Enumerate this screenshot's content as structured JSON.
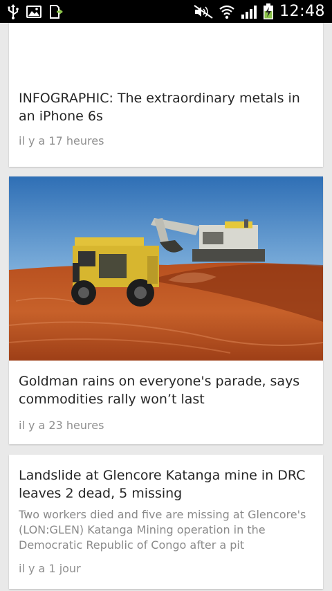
{
  "status_bar": {
    "time": "12:48",
    "icons_left": [
      "usb-icon",
      "image-icon",
      "download-icon"
    ],
    "icons_right": [
      "mute-icon",
      "wifi-icon",
      "signal-icon",
      "battery-icon"
    ],
    "accent": "#8bc34a"
  },
  "feed": {
    "cards": [
      {
        "title": "INFOGRAPHIC: The extraordinary metals in an iPhone 6s",
        "time": "il y a 17 heures"
      },
      {
        "image": "mining-truck-excavator-photo",
        "title": "Goldman rains on everyone's parade, says commodities rally won’t last",
        "time": "il y a 23 heures"
      },
      {
        "title": "Landslide at Glencore Katanga mine in DRC leaves 2 dead, 5 missing",
        "snippet": "Two workers died and five are missing at Glencore's (LON:GLEN) Katanga Mining operation in the Democratic Republic of Congo after a pit",
        "time": "il y a 1 jour"
      }
    ]
  },
  "colors": {
    "background": "#e9e9e9",
    "card": "#ffffff",
    "title_text": "#262626",
    "meta_text": "#8f8f8f"
  }
}
